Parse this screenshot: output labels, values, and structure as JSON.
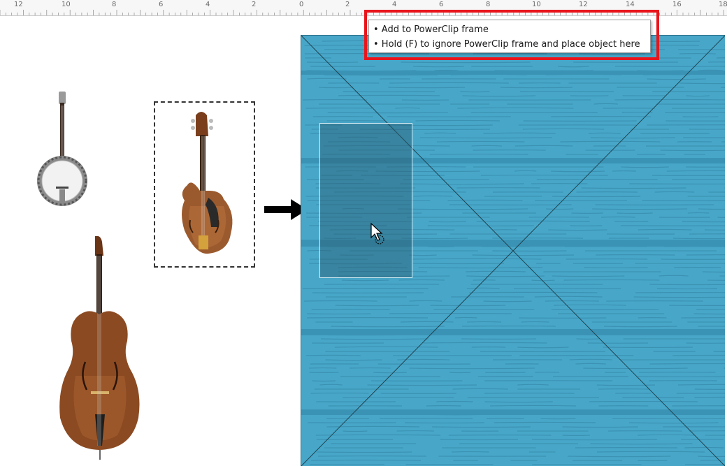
{
  "ruler": {
    "labels": [
      "12",
      "10",
      "8",
      "6",
      "4",
      "2",
      "0",
      "2",
      "4",
      "6",
      "8",
      "10",
      "12",
      "14",
      "16",
      "18"
    ]
  },
  "tooltip": {
    "lines": [
      "• Add to PowerClip frame",
      "• Hold (F) to ignore PowerClip frame and place object here"
    ]
  },
  "colors": {
    "frame_fill": "#48a7c9",
    "highlight": "#e8161c"
  },
  "icons": {
    "arrow": "right-arrow-icon",
    "cursor": "powerclip-cursor-icon"
  }
}
